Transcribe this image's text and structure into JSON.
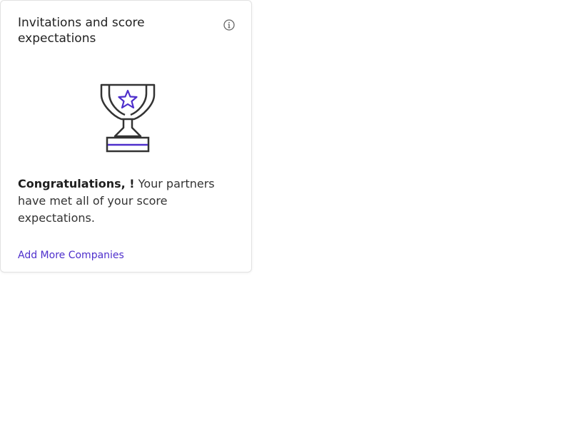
{
  "card": {
    "title": "Invitations and score expectations",
    "info_icon": "info-circle-icon",
    "illustration_icon": "trophy-star-icon",
    "message_bold": "Congratulations, !",
    "message_text": " Your partners have met all of your score expectations.",
    "link_label": "Add More Companies"
  },
  "colors": {
    "accent": "#4e2fcc",
    "icon_stroke": "#333333",
    "info_icon": "#666666",
    "border": "#e2e2e2"
  }
}
